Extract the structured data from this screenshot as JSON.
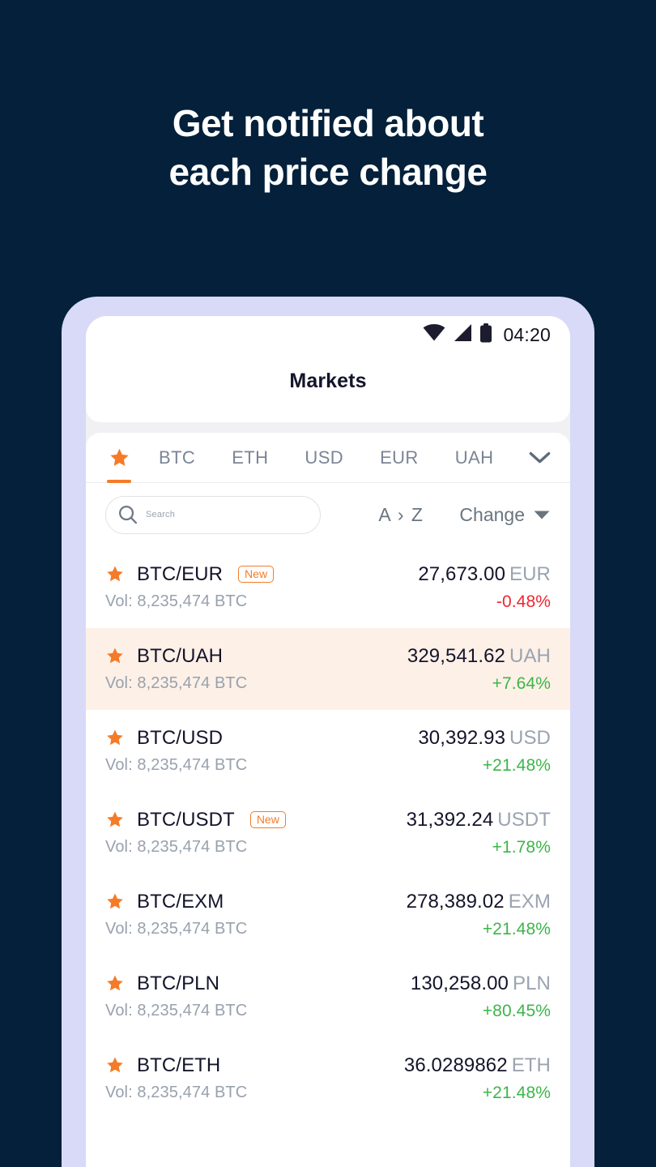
{
  "promo": {
    "headline_line1": "Get notified about",
    "headline_line2": "each price change",
    "background_color": "#04203a",
    "text_color": "#ffffff"
  },
  "phone": {
    "bezel_color": "#d8daf8",
    "screen_background": "#f1f1f4"
  },
  "status_bar": {
    "wifi_icon": "wifi-icon",
    "signal_icon": "signal-icon",
    "battery_icon": "battery-icon",
    "time": "04:20"
  },
  "header": {
    "title": "Markets"
  },
  "tabs": {
    "items": [
      {
        "label": "★",
        "name": "favorites",
        "active": true
      },
      {
        "label": "BTC",
        "name": "btc",
        "active": false
      },
      {
        "label": "ETH",
        "name": "eth",
        "active": false
      },
      {
        "label": "USD",
        "name": "usd",
        "active": false
      },
      {
        "label": "EUR",
        "name": "eur",
        "active": false
      },
      {
        "label": "UAH",
        "name": "uah",
        "active": false
      }
    ],
    "expand_icon": "chevron-down-icon",
    "active_color": "#f47b28",
    "inactive_color": "#7a8596"
  },
  "filters": {
    "search_placeholder": "Search",
    "search_value": "",
    "search_icon": "search-icon",
    "sort_alpha_label": "A › Z",
    "sort_change_label": "Change",
    "sort_change_icon": "caret-down-icon"
  },
  "markets": {
    "volume_prefix": "Vol:",
    "new_badge_label": "New",
    "up_color": "#3cb54a",
    "down_color": "#f0262f",
    "highlight_color": "#fdf0e7",
    "rows": [
      {
        "pair": "BTC/EUR",
        "is_new": true,
        "volume": "Vol: 8,235,474 BTC",
        "price": "27,673.00",
        "currency": "EUR",
        "change": "-0.48%",
        "direction": "down",
        "highlighted": false,
        "favorited": true
      },
      {
        "pair": "BTC/UAH",
        "is_new": false,
        "volume": "Vol: 8,235,474 BTC",
        "price": "329,541.62",
        "currency": "UAH",
        "change": "+7.64%",
        "direction": "up",
        "highlighted": true,
        "favorited": true
      },
      {
        "pair": "BTC/USD",
        "is_new": false,
        "volume": "Vol: 8,235,474 BTC",
        "price": "30,392.93",
        "currency": "USD",
        "change": "+21.48%",
        "direction": "up",
        "highlighted": false,
        "favorited": true
      },
      {
        "pair": "BTC/USDT",
        "is_new": true,
        "volume": "Vol: 8,235,474 BTC",
        "price": "31,392.24",
        "currency": "USDT",
        "change": "+1.78%",
        "direction": "up",
        "highlighted": false,
        "favorited": true
      },
      {
        "pair": "BTC/EXM",
        "is_new": false,
        "volume": "Vol: 8,235,474 BTC",
        "price": "278,389.02",
        "currency": "EXM",
        "change": "+21.48%",
        "direction": "up",
        "highlighted": false,
        "favorited": true
      },
      {
        "pair": "BTC/PLN",
        "is_new": false,
        "volume": "Vol: 8,235,474 BTC",
        "price": "130,258.00",
        "currency": "PLN",
        "change": "+80.45%",
        "direction": "up",
        "highlighted": false,
        "favorited": true
      },
      {
        "pair": "BTC/ETH",
        "is_new": false,
        "volume": "Vol: 8,235,474 BTC",
        "price": "36.0289862",
        "currency": "ETH",
        "change": "+21.48%",
        "direction": "up",
        "highlighted": false,
        "favorited": true
      }
    ]
  }
}
